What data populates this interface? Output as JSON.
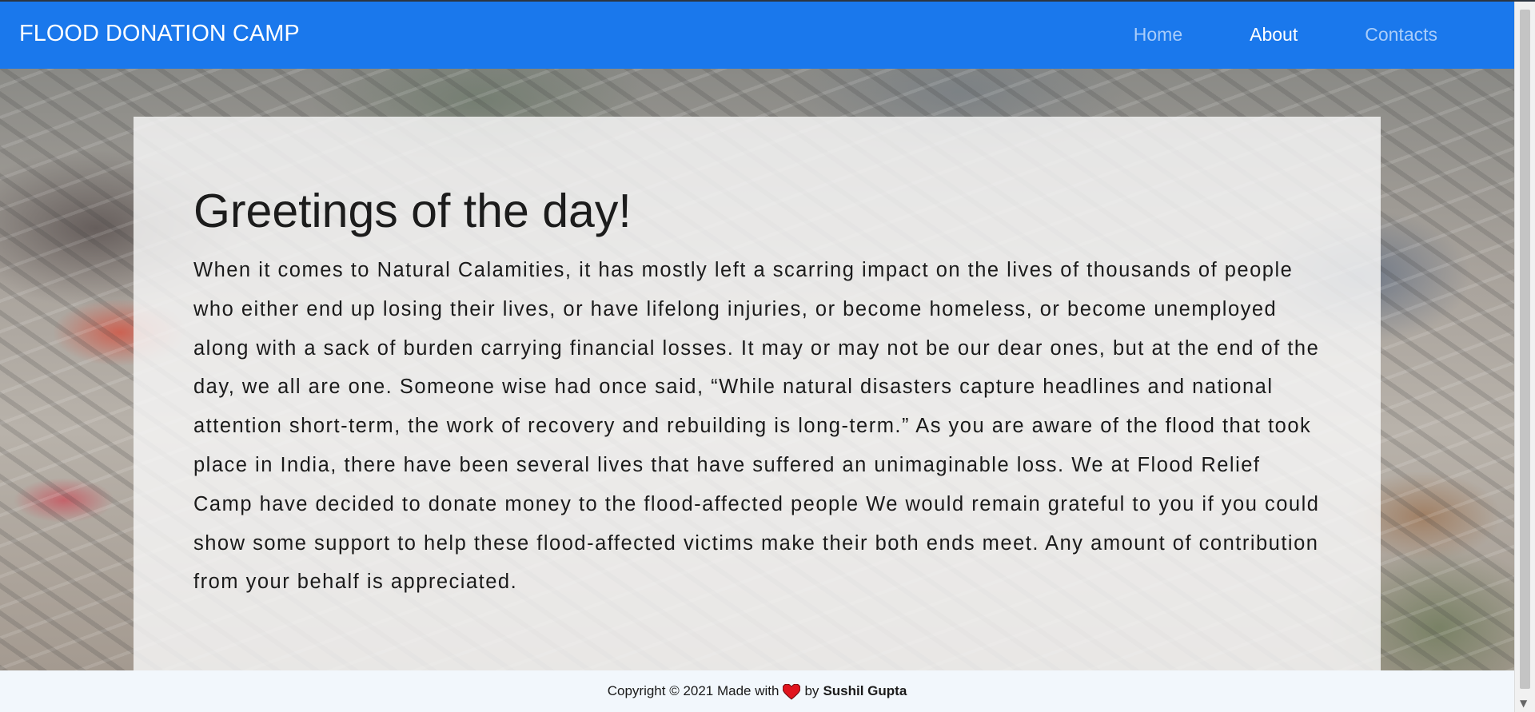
{
  "navbar": {
    "brand": "FLOOD DONATION CAMP",
    "links": [
      {
        "label": "Home",
        "active": false
      },
      {
        "label": "About",
        "active": true
      },
      {
        "label": "Contacts",
        "active": false
      }
    ],
    "background_color": "#1a78ec"
  },
  "main": {
    "heading": "Greetings of the day!",
    "paragraph": "When it comes to Natural Calamities, it has mostly left a scarring impact on the lives of thousands of people who either end up losing their lives, or have lifelong injuries, or become homeless, or become unemployed along with a sack of burden carrying financial losses. It may or may not be our dear ones, but at the end of the day, we all are one. Someone wise had once said, “While natural disasters capture headlines and national attention short-term, the work of recovery and rebuilding is long-term.” As you are aware of the flood that took place in India, there have been several lives that have suffered an unimaginable loss. We at Flood Relief Camp have decided to donate money to the flood-affected people We would remain grateful to you if you could show some support to help these flood-affected victims make their both ends meet. Any amount of contribution from your behalf is appreciated.",
    "background_image": "flood-debris-photo"
  },
  "footer": {
    "prefix": "Copyright © 2021 Made with",
    "icon": "heart-icon",
    "by": "by",
    "author": "Sushil Gupta",
    "heart_color": "#e0141e"
  }
}
